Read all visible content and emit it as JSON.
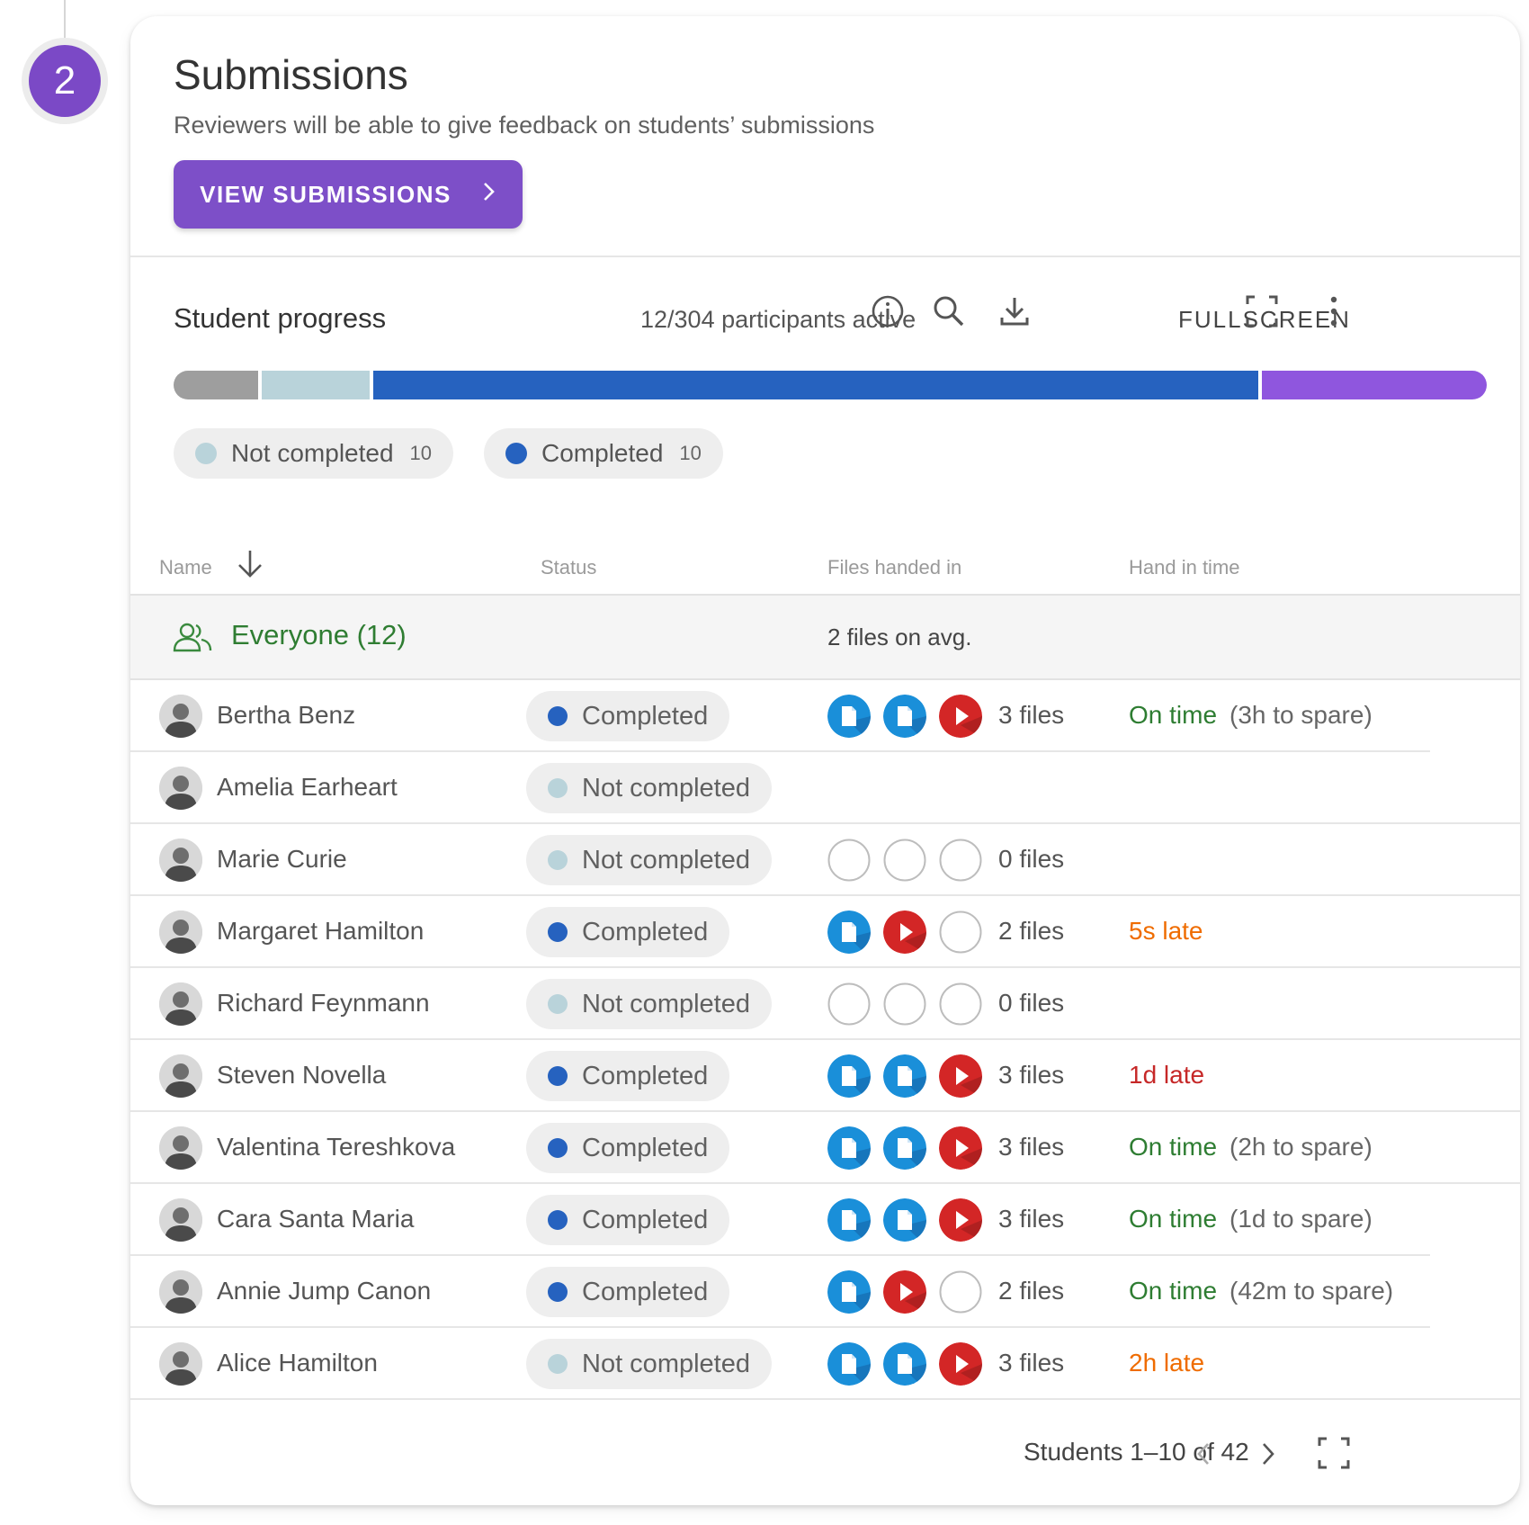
{
  "step": {
    "number": "2"
  },
  "section": {
    "title": "Submissions",
    "subtitle": "Reviewers will be able to give feedback on students’ submissions",
    "button_label": "VIEW SUBMISSIONS"
  },
  "progress": {
    "title": "Student progress",
    "participants_text": "12/304 participants active",
    "fullscreen_label": "FULLSCREEN",
    "bar_segments": [
      {
        "fraction": 0.065,
        "color": "#9e9e9e"
      },
      {
        "fraction": 0.083,
        "color": "#b9d3da"
      },
      {
        "fraction": 0.679,
        "color": "#2662bf"
      },
      {
        "fraction": 0.173,
        "color": "#8f56de"
      }
    ],
    "legend": [
      {
        "label": "Not completed",
        "count": "10",
        "color": "#b9d3da"
      },
      {
        "label": "Completed",
        "count": "10",
        "color": "#2662bf"
      }
    ]
  },
  "table": {
    "columns": [
      "Name",
      "Status",
      "Files handed in",
      "Hand in time"
    ],
    "group": {
      "label": "Everyone (12)",
      "files_avg": "2 files on avg."
    },
    "rows": [
      {
        "name": "Bertha Benz",
        "status": "Completed",
        "files": [
          "doc",
          "doc",
          "video"
        ],
        "file_count": "3 files",
        "hand_in": "On time",
        "hand_in_extra": "(3h to spare)",
        "hand_in_color": "#2e7d32"
      },
      {
        "name": "Amelia Earheart",
        "status": "Not completed",
        "files": [],
        "file_count": "",
        "hand_in": "",
        "hand_in_extra": "",
        "hand_in_color": "#2e7d32"
      },
      {
        "name": "Marie Curie",
        "status": "Not completed",
        "files": [
          "empty",
          "empty",
          "empty"
        ],
        "file_count": "0 files",
        "hand_in": "",
        "hand_in_extra": "",
        "hand_in_color": "#2e7d32"
      },
      {
        "name": "Margaret Hamilton",
        "status": "Completed",
        "files": [
          "doc",
          "video",
          "empty"
        ],
        "file_count": "2 files",
        "hand_in": "5s late",
        "hand_in_extra": "",
        "hand_in_color": "#ef6c00"
      },
      {
        "name": "Richard Feynmann",
        "status": "Not completed",
        "files": [
          "empty",
          "empty",
          "empty"
        ],
        "file_count": "0 files",
        "hand_in": "",
        "hand_in_extra": "",
        "hand_in_color": "#2e7d32"
      },
      {
        "name": "Steven Novella",
        "status": "Completed",
        "files": [
          "doc",
          "doc",
          "video"
        ],
        "file_count": "3 files",
        "hand_in": "1d late",
        "hand_in_extra": "",
        "hand_in_color": "#c62828"
      },
      {
        "name": "Valentina Tereshkova",
        "status": "Completed",
        "files": [
          "doc",
          "doc",
          "video"
        ],
        "file_count": "3 files",
        "hand_in": "On time",
        "hand_in_extra": "(2h to spare)",
        "hand_in_color": "#2e7d32"
      },
      {
        "name": "Cara Santa Maria",
        "status": "Completed",
        "files": [
          "doc",
          "doc",
          "video"
        ],
        "file_count": "3 files",
        "hand_in": "On time",
        "hand_in_extra": "(1d to spare)",
        "hand_in_color": "#2e7d32"
      },
      {
        "name": "Annie Jump Canon",
        "status": "Completed",
        "files": [
          "doc",
          "video",
          "empty"
        ],
        "file_count": "2 files",
        "hand_in": "On time",
        "hand_in_extra": "(42m to spare)",
        "hand_in_color": "#2e7d32"
      },
      {
        "name": "Alice Hamilton",
        "status": "Not completed",
        "files": [
          "doc",
          "doc",
          "video"
        ],
        "file_count": "3 files",
        "hand_in": "2h late",
        "hand_in_extra": "",
        "hand_in_color": "#ef6c00"
      }
    ]
  },
  "footer": {
    "range_text": "Students 1–10 of 42"
  },
  "colors": {
    "accent": "#7d4fc8",
    "completed": "#2662bf",
    "not_completed": "#b9d3da",
    "doc_icon": "#1a8fd9",
    "video_icon": "#d32626"
  },
  "icons": [
    "info-icon",
    "search-icon",
    "download-icon",
    "fullscreen-icon",
    "more-vert-icon",
    "sort-down-icon",
    "group-icon",
    "chevron-left-icon",
    "chevron-right-icon"
  ]
}
